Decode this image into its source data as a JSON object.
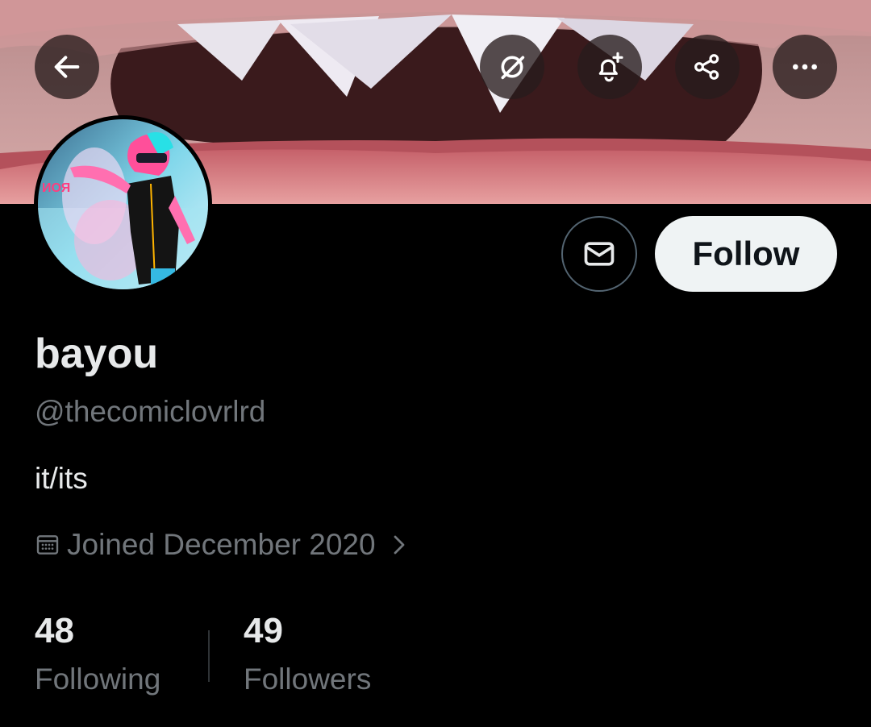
{
  "header": {
    "back_icon": "arrow-left-icon",
    "grok_icon": "grok-icon",
    "notify_icon": "bell-plus-icon",
    "share_icon": "share-icon",
    "more_icon": "more-horizontal-icon"
  },
  "profile": {
    "display_name": "bayou",
    "handle": "@thecomiclovrlrd",
    "bio": "it/its",
    "joined": "Joined December 2020"
  },
  "actions": {
    "message_icon": "envelope-icon",
    "follow_label": "Follow"
  },
  "stats": {
    "following_count": "48",
    "following_label": "Following",
    "followers_count": "49",
    "followers_label": "Followers"
  },
  "colors": {
    "background": "#000000",
    "primary_text": "#e7e9ea",
    "secondary_text": "#71767b",
    "follow_button_bg": "#eff3f4",
    "border": "#536471"
  }
}
